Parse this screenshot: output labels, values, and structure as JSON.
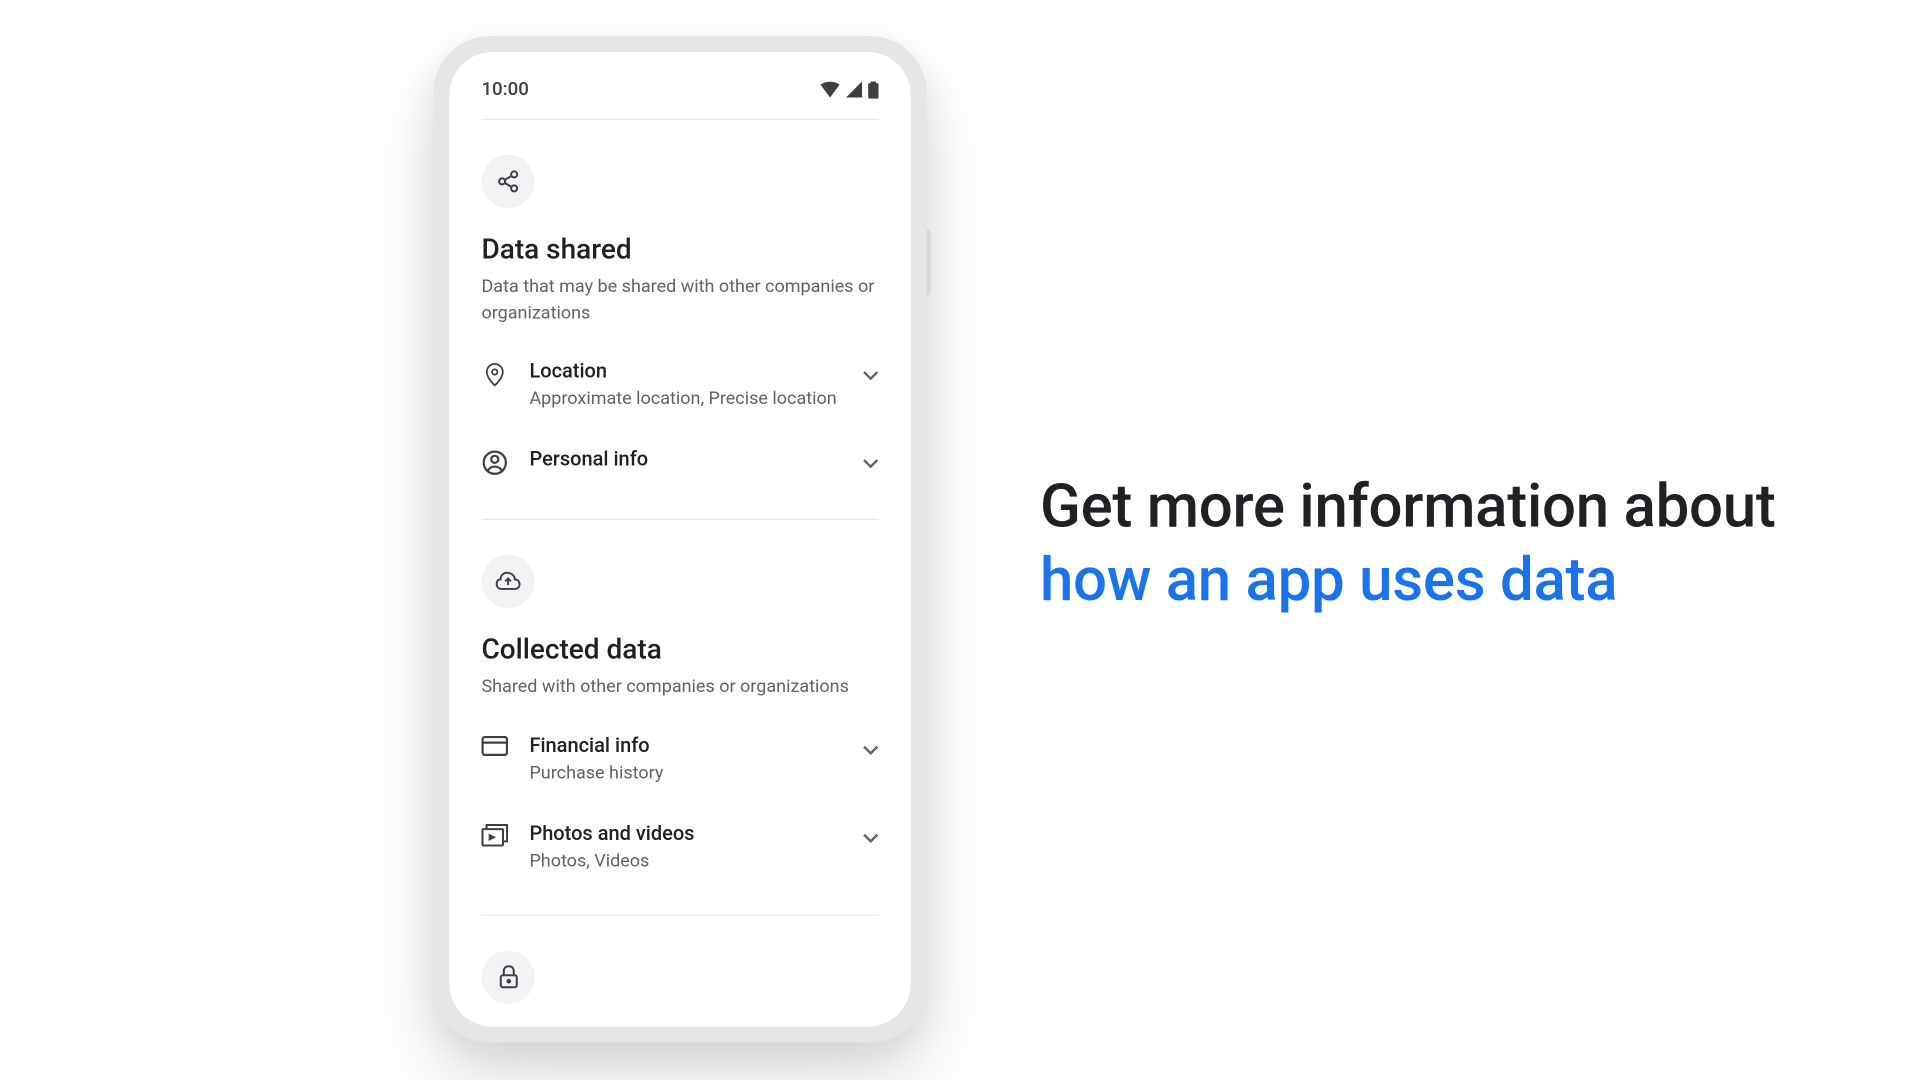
{
  "status": {
    "time": "10:00"
  },
  "sections": {
    "shared": {
      "title": "Data shared",
      "subtitle": "Data that may be shared with other companies or organizations",
      "rows": [
        {
          "title": "Location",
          "subtitle": "Approximate location, Precise location"
        },
        {
          "title": "Personal info",
          "subtitle": ""
        }
      ]
    },
    "collected": {
      "title": "Collected data",
      "subtitle": "Shared with other companies or organizations",
      "rows": [
        {
          "title": "Financial info",
          "subtitle": "Purchase history"
        },
        {
          "title": "Photos and videos",
          "subtitle": "Photos, Videos"
        }
      ]
    }
  },
  "caption": {
    "line1": "Get more information about",
    "line2": "how an app uses data"
  }
}
